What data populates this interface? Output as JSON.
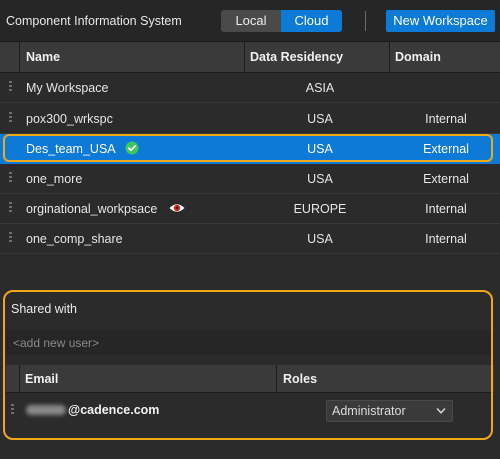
{
  "header": {
    "title": "Component Information System",
    "toggle": {
      "local_label": "Local",
      "cloud_label": "Cloud",
      "selected": "Cloud"
    },
    "new_workspace_label": "New Workspace"
  },
  "workspaces": {
    "columns": {
      "name": "Name",
      "residency": "Data Residency",
      "domain": "Domain"
    },
    "rows": [
      {
        "name": "My Workspace",
        "residency": "ASIA",
        "domain": ""
      },
      {
        "name": "pox300_wrkspc",
        "residency": "USA",
        "domain": "Internal"
      },
      {
        "name": "Des_team_USA",
        "residency": "USA",
        "domain": "External",
        "selected": true,
        "icon": "check-circle-icon"
      },
      {
        "name": "one_more",
        "residency": "USA",
        "domain": "External"
      },
      {
        "name": "orginational_workpsace",
        "residency": "EUROPE",
        "domain": "Internal",
        "icon": "eye-icon"
      },
      {
        "name": "one_comp_share",
        "residency": "USA",
        "domain": "Internal"
      }
    ]
  },
  "shared": {
    "title": "Shared with",
    "add_user_placeholder": "<add new user>",
    "columns": {
      "email": "Email",
      "roles": "Roles"
    },
    "users": [
      {
        "email_visible": "@cadence.com",
        "role": "Administrator"
      }
    ]
  },
  "colors": {
    "accent": "#0e7ad8",
    "highlight_outline": "#f0a818",
    "check_green": "#3cc85a",
    "eye_red": "#e02020"
  }
}
